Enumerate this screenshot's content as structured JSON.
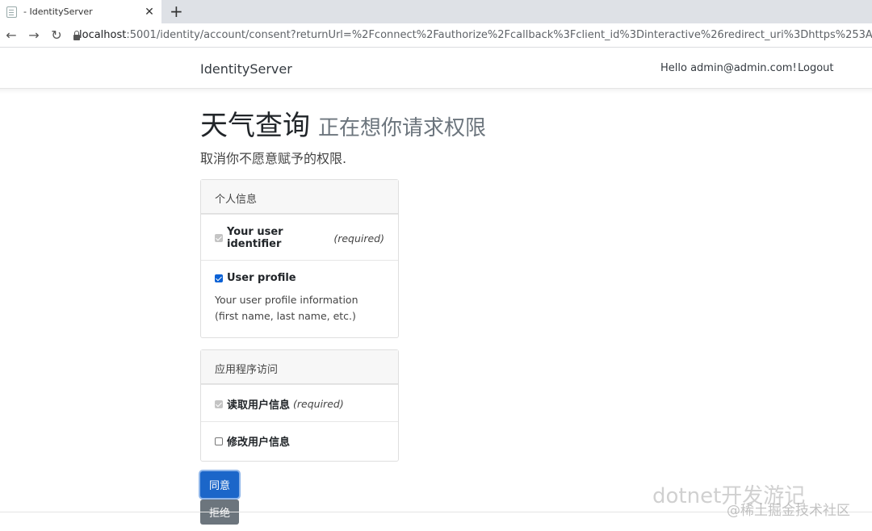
{
  "browser": {
    "tab_title": "- IdentityServer",
    "url_host": "localhost",
    "url_path": ":5001/identity/account/consent?returnUrl=%2Fconnect%2Fauthorize%2Fcallback%3Fclient_id%3Dinteractive%26redirect_uri%3Dhttps%253A%252F%252Flocalho"
  },
  "navbar": {
    "brand": "IdentityServer",
    "greeting": "Hello admin@admin.com!",
    "logout": "Logout"
  },
  "consent": {
    "client_name": "天气查询",
    "requesting": "正在想你请求权限",
    "lead": "取消你不愿意赋予的权限.",
    "identity_section": {
      "header": "个人信息",
      "scopes": [
        {
          "name": "Your user identifier",
          "required": "(required)",
          "checked": true,
          "disabled": true,
          "description": ""
        },
        {
          "name": "User profile",
          "required": "",
          "checked": true,
          "disabled": false,
          "description": "Your user profile information (first name, last name, etc.)"
        }
      ]
    },
    "api_section": {
      "header": "应用程序访问",
      "scopes": [
        {
          "name": "读取用户信息",
          "required": "(required)",
          "checked": true,
          "disabled": true,
          "description": ""
        },
        {
          "name": "修改用户信息",
          "required": "",
          "checked": false,
          "disabled": false,
          "description": ""
        }
      ]
    },
    "buttons": {
      "accept": "同意",
      "deny": "拒绝"
    }
  },
  "watermark": {
    "line1": "dotnet开发游记",
    "line2": "@稀土掘金技术社区"
  },
  "colors": {
    "primary": "#1b66c9",
    "secondary": "#6c757d"
  }
}
